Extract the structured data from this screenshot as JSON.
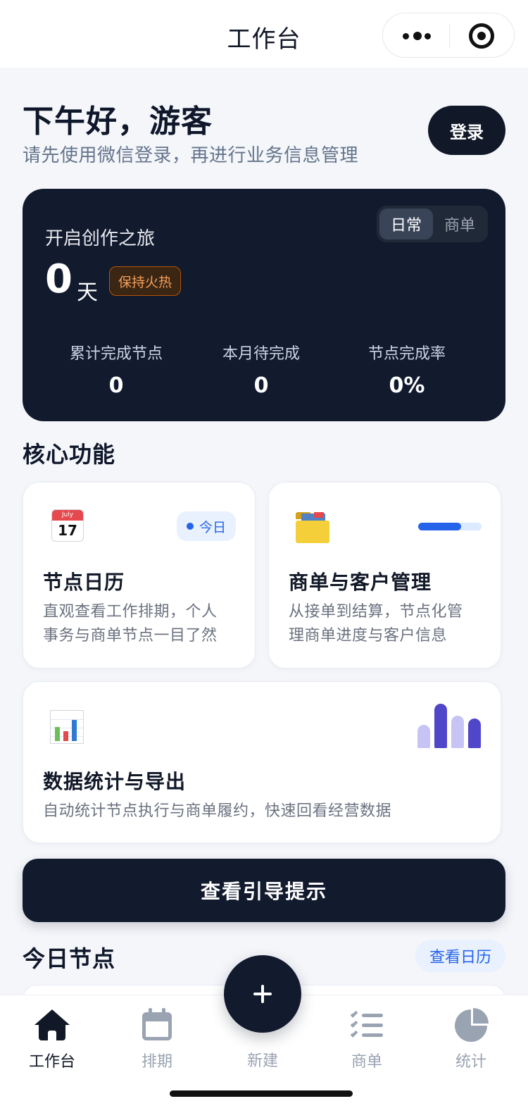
{
  "navbar": {
    "title": "工作台"
  },
  "header": {
    "greeting": "下午好，游客",
    "subtitle": "请先使用微信登录，再进行业务信息管理",
    "login_label": "登录"
  },
  "journey_card": {
    "title": "开启创作之旅",
    "toggle": {
      "active": "日常",
      "inactive": "商单"
    },
    "days_value": "0",
    "days_unit": "天",
    "badge": "保持火热",
    "stats": [
      {
        "label": "累计完成节点",
        "value": "0"
      },
      {
        "label": "本月待完成",
        "value": "0"
      },
      {
        "label": "节点完成率",
        "value": "0%"
      }
    ]
  },
  "core": {
    "section_title": "核心功能",
    "calendar_card": {
      "icon_month": "July",
      "icon_day": "17",
      "pill": "今日",
      "title": "节点日历",
      "desc_line1": "直观查看工作排期，个人",
      "desc_line2": "事务与商单节点一目了然"
    },
    "orders_card": {
      "progress": 0.68,
      "title": "商单与客户管理",
      "desc_line1": "从接单到结算，节点化管",
      "desc_line2": "理商单进度与客户信息"
    },
    "stats_card": {
      "title": "数据统计与导出",
      "desc": "自动统计节点执行与商单履约，快速回看经营数据"
    }
  },
  "guide_button": "查看引导提示",
  "today": {
    "section_title": "今日节点",
    "view_calendar": "查看日历"
  },
  "tabbar": {
    "items": [
      {
        "label": "工作台",
        "icon": "home-icon",
        "active": true
      },
      {
        "label": "排期",
        "icon": "calendar-icon",
        "active": false
      },
      {
        "label": "新建",
        "icon": "plus-icon",
        "active": false
      },
      {
        "label": "商单",
        "icon": "checklist-icon",
        "active": false
      },
      {
        "label": "统计",
        "icon": "pie-chart-icon",
        "active": false
      }
    ]
  },
  "colors": {
    "primary_dark": "#121a2e",
    "accent_blue": "#2563eb",
    "badge_orange": "#f59e57",
    "muted_text": "#64748b"
  }
}
